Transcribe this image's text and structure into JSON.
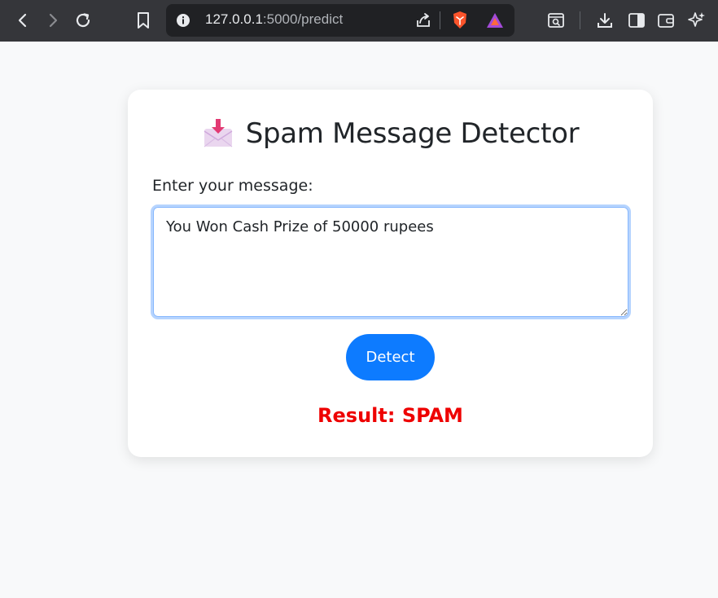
{
  "browser": {
    "url_host": "127.0.0.1",
    "url_path": ":5000/predict"
  },
  "page": {
    "title": "Spam Message Detector",
    "title_icon": "envelope-download-icon",
    "input_label": "Enter your message:",
    "message_value": "You Won Cash Prize of 50000 rupees",
    "detect_label": "Detect",
    "result_text": "Result: SPAM"
  },
  "colors": {
    "accent": "#0d7bff",
    "result": "#ee0000",
    "background": "#f8f9fa"
  }
}
